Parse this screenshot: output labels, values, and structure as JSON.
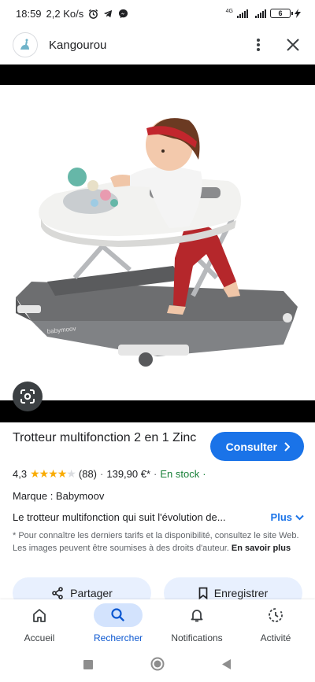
{
  "status_bar": {
    "time": "18:59",
    "speed": "2,2 Ko/s",
    "network": "4G",
    "battery": "6"
  },
  "header": {
    "site_name": "Kangourou",
    "more_icon": "more-vert-icon",
    "close_icon": "close-icon"
  },
  "product": {
    "title": "Trotteur multifonction 2 en 1 Zinc",
    "consult_label": "Consulter",
    "rating": "4,3",
    "stars_filled": 4,
    "reviews": "(88)",
    "price": "139,90 €*",
    "stock": "En stock",
    "brand": "Marque : Babymoov",
    "description": "Le trotteur multifonction qui suit l'évolution de...",
    "plus_label": "Plus",
    "note": "* Pour connaître les derniers tarifs et la disponibilité, consultez le site Web. Les images peuvent être soumises à des droits d'auteur.",
    "note_link": "En savoir plus",
    "walker_brand": "babymoov"
  },
  "actions": {
    "share_label": "Partager",
    "save_label": "Enregistrer"
  },
  "bottom_nav": {
    "items": [
      {
        "label": "Accueil",
        "icon": "home-icon"
      },
      {
        "label": "Rechercher",
        "icon": "search-icon"
      },
      {
        "label": "Notifications",
        "icon": "bell-icon"
      },
      {
        "label": "Activité",
        "icon": "activity-icon"
      }
    ]
  },
  "colors": {
    "accent": "#1a73e8",
    "stock_green": "#188038",
    "star": "#f9ab00",
    "nav_active_bg": "#d3e3fd"
  }
}
